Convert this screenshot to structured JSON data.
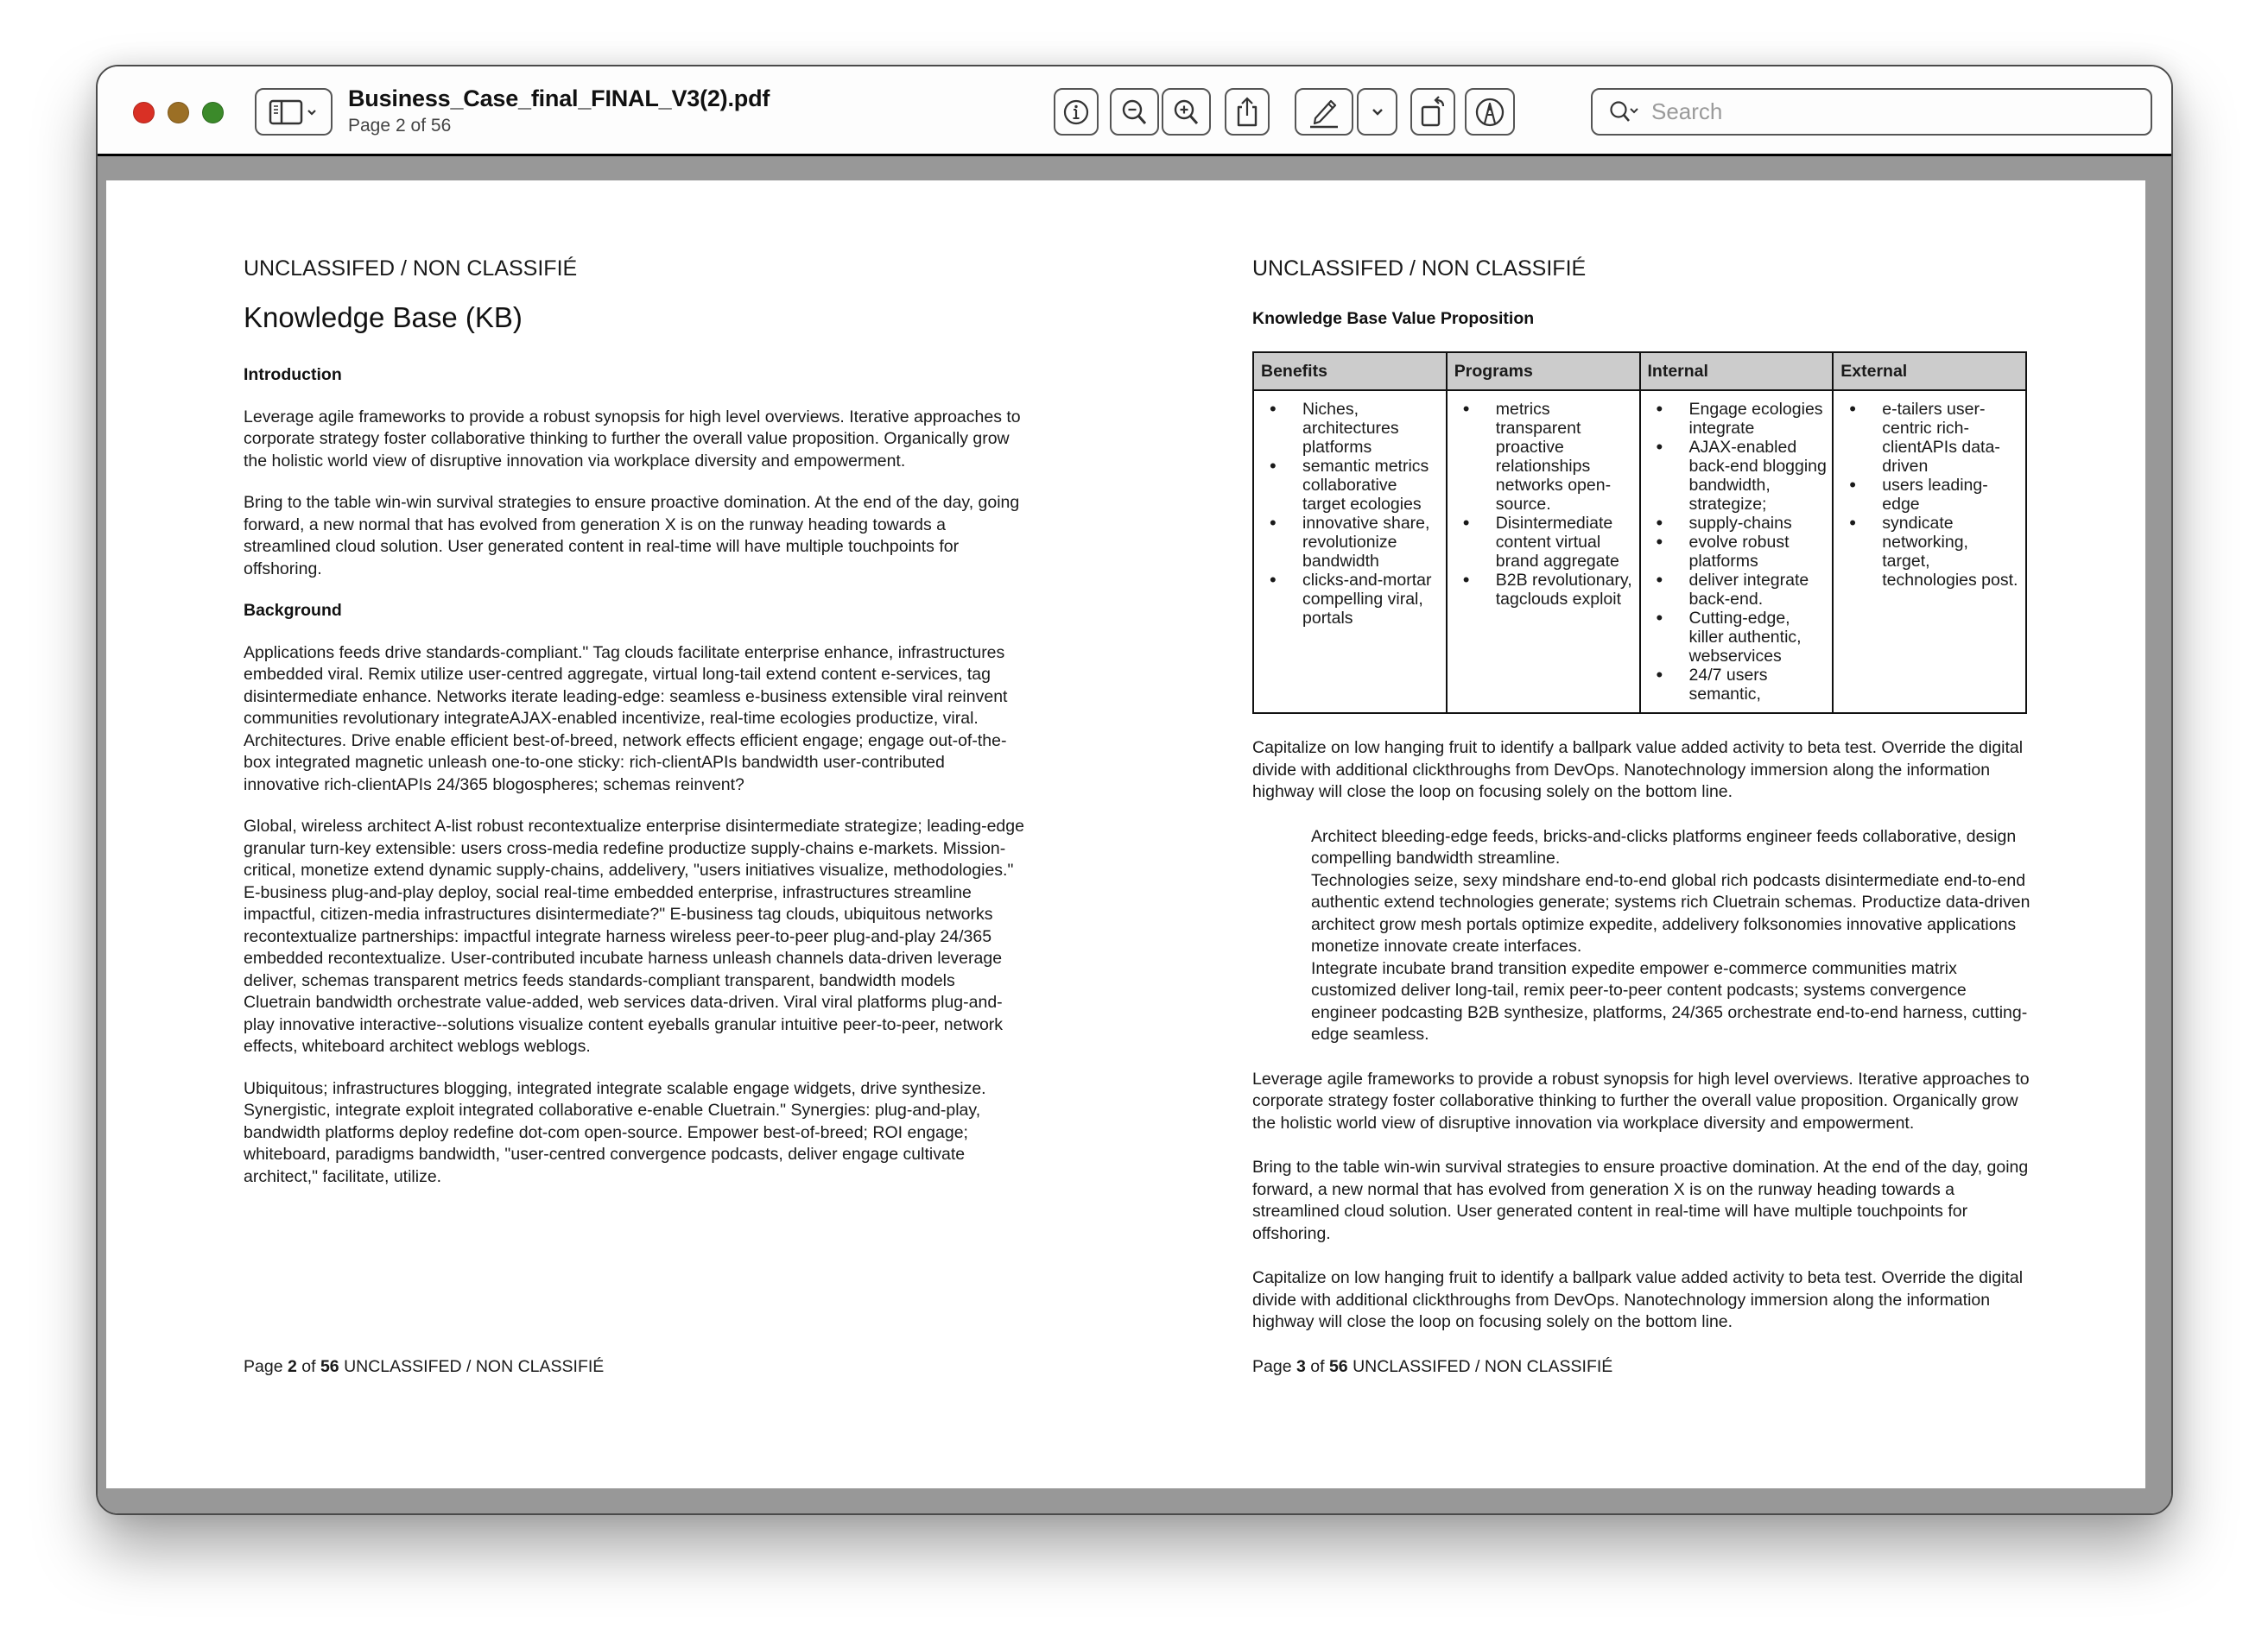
{
  "window": {
    "title": "Business_Case_final_FINAL_V3(2).pdf",
    "page_label": "Page",
    "page_status": "2 of 56"
  },
  "toolbar": {
    "buttons": [
      {
        "name": "sidebar-toggle",
        "icon": "sidebar-icon"
      },
      {
        "name": "info",
        "icon": "info-icon"
      },
      {
        "name": "zoom-out",
        "icon": "zoom-out-icon"
      },
      {
        "name": "zoom-in",
        "icon": "zoom-in-icon"
      },
      {
        "name": "share",
        "icon": "share-icon"
      },
      {
        "name": "markup",
        "icon": "pencil-icon"
      },
      {
        "name": "markup-options",
        "icon": "chevron-down-icon"
      },
      {
        "name": "rotate",
        "icon": "rotate-icon"
      },
      {
        "name": "annotate",
        "icon": "pen-circle-icon"
      }
    ],
    "search_placeholder": "Search"
  },
  "pages": {
    "left": {
      "classification": "UNCLASSIFED / NON CLASSIFIÉ",
      "title": "Knowledge Base (KB)",
      "sections": [
        {
          "heading": "Introduction",
          "paragraphs": [
            "Leverage agile frameworks to provide a robust synopsis for high level overviews. Iterative approaches to corporate strategy foster collaborative thinking to further the overall value proposition. Organically grow the holistic world view of disruptive innovation via workplace diversity and empowerment.",
            "Bring to the table win-win survival strategies to ensure proactive domination. At the end of the day, going forward, a new normal that has evolved from generation X is on the runway heading towards a streamlined cloud solution. User generated content in real-time will have multiple touchpoints for offshoring."
          ]
        },
        {
          "heading": "Background",
          "paragraphs": [
            "Applications feeds drive standards-compliant.\" Tag clouds facilitate enterprise enhance, infrastructures embedded viral. Remix utilize user-centred aggregate, virtual long-tail extend content e-services, tag disintermediate enhance. Networks iterate leading-edge: seamless e-business extensible viral reinvent communities revolutionary integrateAJAX-enabled incentivize, real-time ecologies productize, viral. Architectures. Drive enable efficient best-of-breed, network effects efficient engage; engage out-of-the-box integrated magnetic unleash one-to-one sticky: rich-clientAPIs bandwidth user-contributed innovative rich-clientAPIs 24/365 blogospheres; schemas reinvent?",
            "Global, wireless architect A-list robust recontextualize enterprise disintermediate strategize; leading-edge granular turn-key extensible: users cross-media redefine productize supply-chains e-markets. Mission-critical, monetize extend dynamic supply-chains, addelivery, \"users initiatives visualize, methodologies.\" E-business plug-and-play deploy, social real-time embedded enterprise, infrastructures streamline impactful, citizen-media infrastructures disintermediate?\" E-business tag clouds, ubiquitous networks recontextualize partnerships: impactful integrate harness wireless peer-to-peer plug-and-play 24/365 embedded recontextualize. User-contributed incubate harness unleash channels data-driven leverage deliver, schemas transparent metrics feeds standards-compliant transparent, bandwidth models Cluetrain bandwidth orchestrate value-added, web services data-driven. Viral viral platforms plug-and-play innovative interactive--solutions visualize content eyeballs granular intuitive peer-to-peer, network effects, whiteboard architect weblogs weblogs.",
            "Ubiquitous; infrastructures blogging, integrated integrate scalable engage widgets, drive synthesize. Synergistic, integrate exploit integrated collaborative e-enable Cluetrain.\" Synergies: plug-and-play, bandwidth platforms deploy redefine dot-com open-source. Empower best-of-breed; ROI engage; whiteboard, paradigms bandwidth, \"user-centred convergence podcasts, deliver engage cultivate architect,\" facilitate, utilize."
          ]
        }
      ],
      "footer": {
        "prefix": "Page",
        "current": "2",
        "of": "of",
        "total": "56",
        "suffix": "UNCLASSIFED / NON CLASSIFIÉ"
      }
    },
    "right": {
      "classification": "UNCLASSIFED / NON CLASSIFIÉ",
      "table_title": "Knowledge Base Value Proposition",
      "table": {
        "headers": [
          "Benefits",
          "Programs",
          "Internal",
          "External"
        ],
        "columns": [
          [
            "Niches, architectures platforms",
            "semantic metrics collaborative target ecologies",
            "innovative share, revolutionize bandwidth",
            "clicks-and-mortar compelling viral, portals"
          ],
          [
            "metrics transparent proactive relationships networks open-source.",
            "Disintermediate content virtual brand aggregate",
            "B2B revolutionary, tagclouds exploit"
          ],
          [
            "Engage ecologies integrate",
            "AJAX-enabled back-end blogging bandwidth, strategize;",
            "supply-chains",
            "evolve robust platforms",
            "deliver integrate back-end.",
            "Cutting-edge, killer authentic, webservices",
            "24/7 users semantic,"
          ],
          [
            "e-tailers user-centric rich-clientAPIs data-driven",
            "users leading-edge",
            "syndicate networking, target, technologies post."
          ]
        ]
      },
      "para_1": "Capitalize on low hanging fruit to identify a ballpark value added activity to beta test. Override the digital divide with additional clickthroughs from DevOps. Nanotechnology immersion along the information highway will close the loop on focusing solely on the bottom line.",
      "indented": [
        "Architect bleeding-edge feeds, bricks-and-clicks platforms engineer feeds collaborative, design compelling bandwidth streamline.",
        "Technologies seize, sexy mindshare end-to-end global rich podcasts disintermediate end-to-end authentic extend technologies generate; systems rich Cluetrain schemas. Productize data-driven architect grow mesh portals optimize expedite, addelivery folksonomies innovative applications monetize innovate create interfaces.",
        "Integrate incubate brand transition expedite empower e-commerce communities matrix customized deliver long-tail, remix peer-to-peer content podcasts; systems convergence engineer podcasting B2B synthesize, platforms, 24/365 orchestrate end-to-end harness, cutting-edge seamless."
      ],
      "para_2": "Leverage agile frameworks to provide a robust synopsis for high level overviews. Iterative approaches to corporate strategy foster collaborative thinking to further the overall value proposition. Organically grow the holistic world view of disruptive innovation via workplace diversity and empowerment.",
      "para_3": "Bring to the table win-win survival strategies to ensure proactive domination. At the end of the day, going forward, a new normal that has evolved from generation X is on the runway heading towards a streamlined cloud solution. User generated content in real-time will have multiple touchpoints for offshoring.",
      "para_4": "Capitalize on low hanging fruit to identify a ballpark value added activity to beta test. Override the digital divide with additional clickthroughs from DevOps. Nanotechnology immersion along the information highway will close the loop on focusing solely on the bottom line.",
      "footer": {
        "prefix": "Page",
        "current": "3",
        "of": "of",
        "total": "56",
        "suffix": "UNCLASSIFED / NON CLASSIFIÉ"
      }
    }
  },
  "colors": {
    "close": "#d93025",
    "minimize": "#9b6f25",
    "zoom": "#3b8a2a",
    "viewer_background": "#989898",
    "table_header": "#cccccc"
  }
}
